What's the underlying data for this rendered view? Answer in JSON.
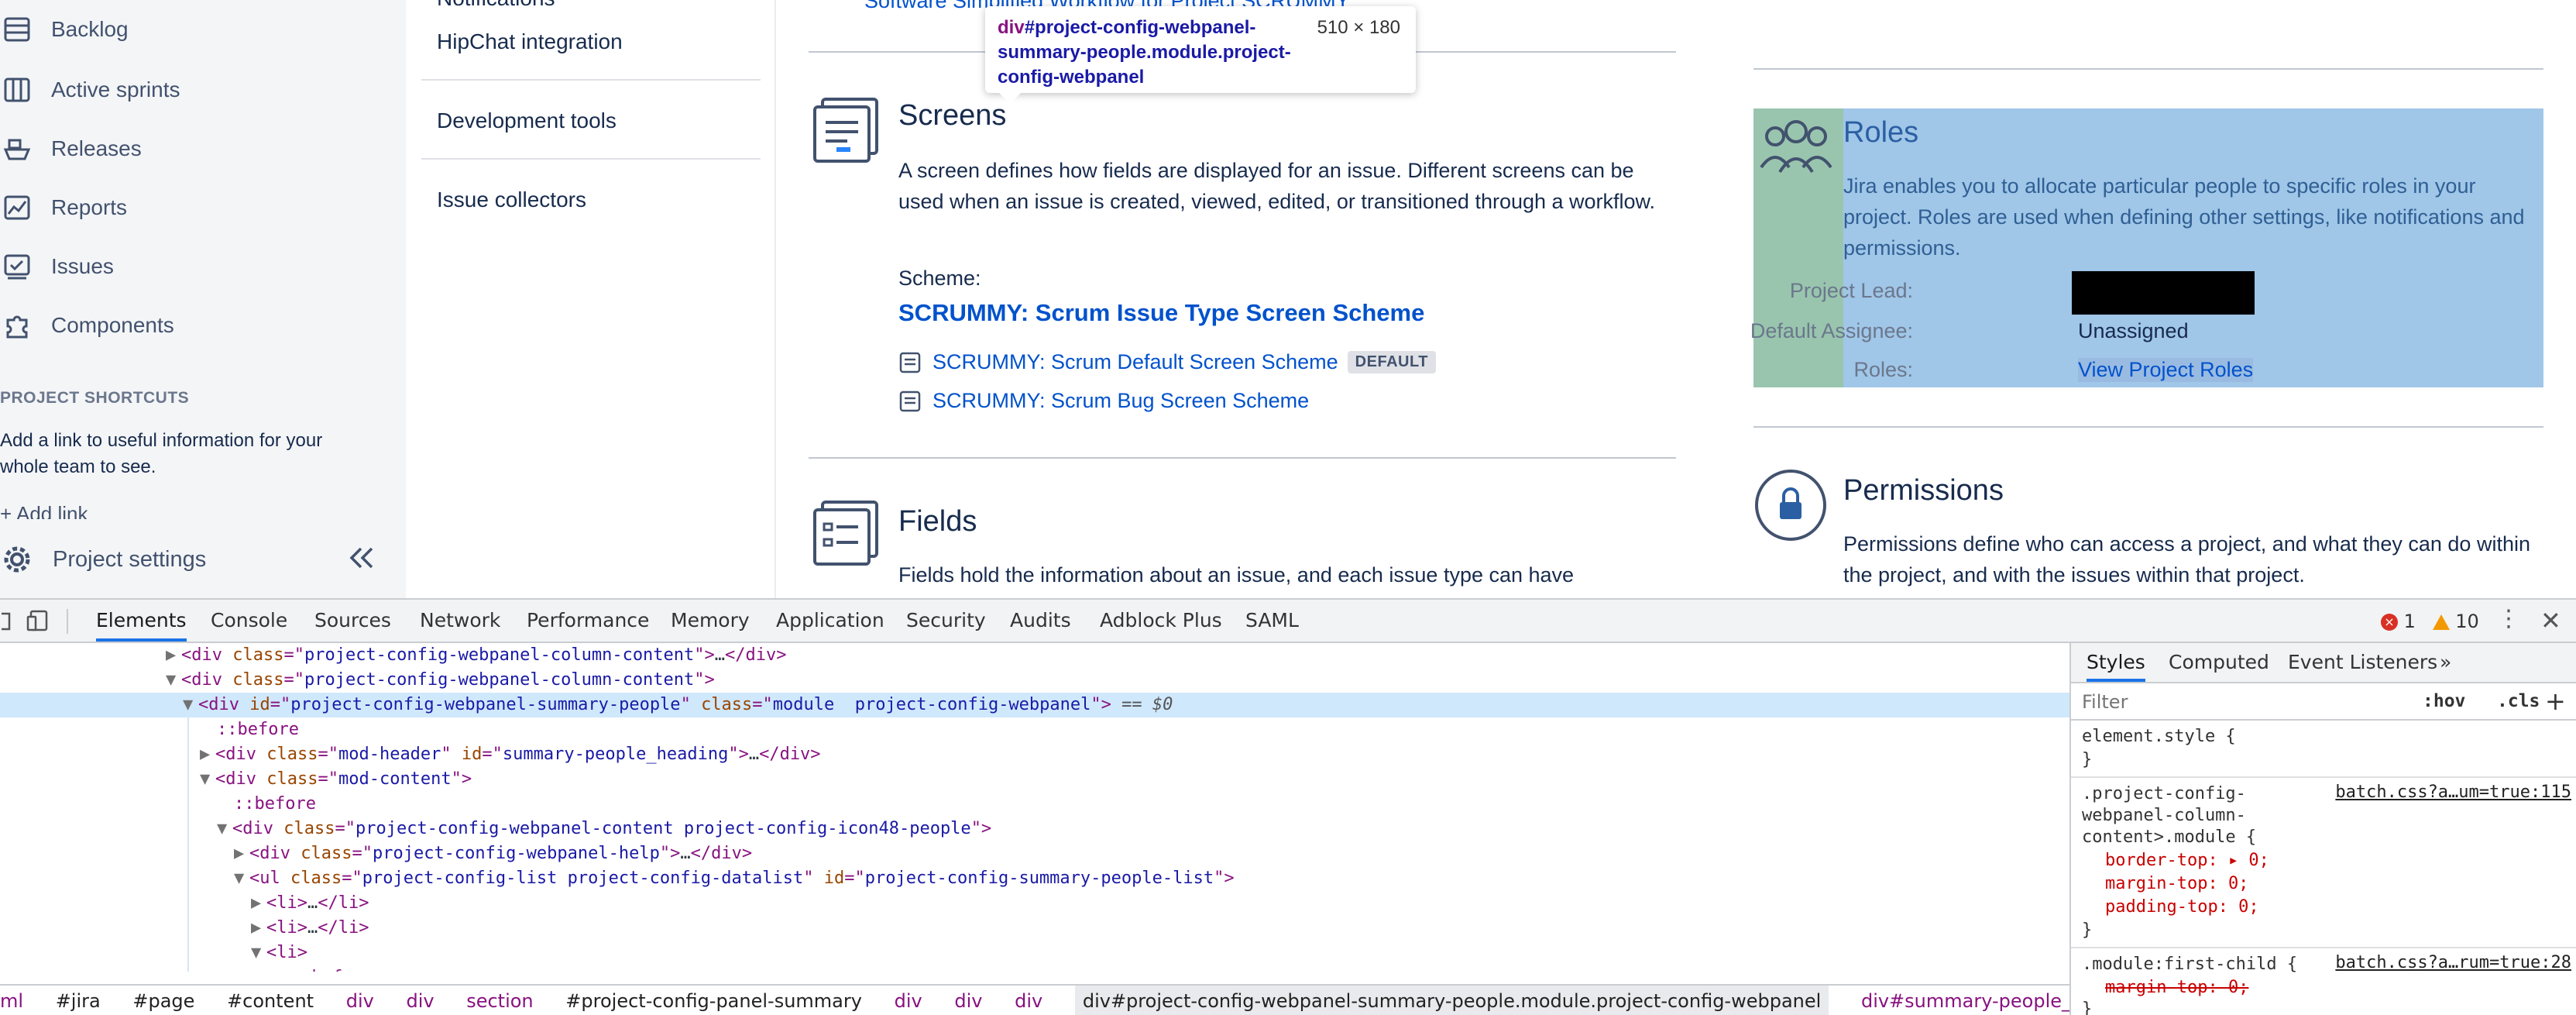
{
  "sidebar": {
    "items": [
      {
        "label": "Backlog",
        "icon": "backlog-icon"
      },
      {
        "label": "Active sprints",
        "icon": "board-icon"
      },
      {
        "label": "Releases",
        "icon": "ship-icon"
      },
      {
        "label": "Reports",
        "icon": "chart-icon"
      },
      {
        "label": "Issues",
        "icon": "issues-icon"
      },
      {
        "label": "Components",
        "icon": "puzzle-icon"
      }
    ],
    "shortcuts_heading": "PROJECT SHORTCUTS",
    "shortcuts_desc": "Add a link to useful information for your whole team to see.",
    "add_link": "+ Add link",
    "settings_label": "Project settings"
  },
  "subnav": {
    "items": [
      "Notifications",
      "HipChat integration",
      "Development tools",
      "Issue collectors"
    ]
  },
  "main": {
    "top_link": "Software Simplified Workflow for Project SCRUMMY",
    "screens": {
      "title": "Screens",
      "desc": "A screen defines how fields are displayed for an issue. Different screens can be used when an issue is created, viewed, edited, or transitioned through a workflow.",
      "scheme_label": "Scheme:",
      "scheme_name": "SCRUMMY: Scrum Issue Type Screen Scheme",
      "rows": [
        {
          "label": "SCRUMMY: Scrum Default Screen Scheme",
          "badge": "DEFAULT"
        },
        {
          "label": "SCRUMMY: Scrum Bug Screen Scheme",
          "badge": ""
        }
      ]
    },
    "fields": {
      "title": "Fields",
      "desc": "Fields hold the information about an issue, and each issue type can have"
    },
    "roles": {
      "title": "Roles",
      "desc": "Jira enables you to allocate particular people to specific roles in your project. Roles are used when defining other settings, like notifications and permissions.",
      "lead_label": "Project Lead:",
      "assignee_label": "Default Assignee:",
      "assignee_value": "Unassigned",
      "roles_label": "Roles:",
      "roles_link": "View Project Roles"
    },
    "permissions": {
      "title": "Permissions",
      "desc": "Permissions define who can access a project, and what they can do within the project, and with the issues within that project."
    }
  },
  "tooltip": {
    "tag": "div",
    "selector": "#project-config-webpanel-summary-people.module.project-config-webpanel",
    "size": "510 × 180"
  },
  "devtools": {
    "tabs": [
      "Elements",
      "Console",
      "Sources",
      "Network",
      "Performance",
      "Memory",
      "Application",
      "Security",
      "Audits",
      "Adblock Plus",
      "SAML"
    ],
    "errors": "1",
    "warnings": "10",
    "breadcrumbs": [
      "ml",
      "#jira",
      "#page",
      "#content",
      "div",
      "div",
      "section",
      "#project-config-panel-summary",
      "div",
      "div",
      "div",
      "div#project-config-webpanel-summary-people.module.project-config-webpanel",
      "div#summary-people_heading.mod-header"
    ],
    "styles_tabs": [
      "Styles",
      "Computed",
      "Event Listeners",
      "»"
    ],
    "filter_placeholder": "Filter",
    "hov": ":hov",
    "cls": ".cls",
    "rule1_selector": "element.style {",
    "rule2_selector_lines": [
      ".project-config-",
      "webpanel-column-",
      "content>.module {"
    ],
    "rule2_source": "batch.css?a…um=true:115",
    "rule2_props": [
      "border-top: ▸ 0;",
      "margin-top: 0;",
      "padding-top: 0;"
    ],
    "rule3_selector": ".module:first-child {",
    "rule3_source": "batch.css?a…rum=true:28",
    "rule3_prop": "margin-top: 0;"
  }
}
